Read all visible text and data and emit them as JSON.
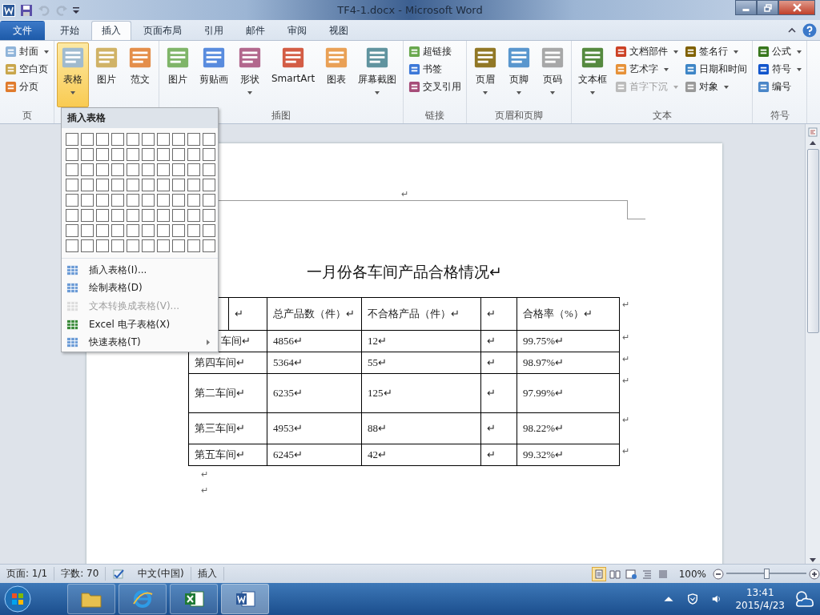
{
  "window": {
    "title": "TF4-1.docx - Microsoft Word"
  },
  "tabs": [
    {
      "label": "文件",
      "kind": "file",
      "selected": false
    },
    {
      "label": "开始",
      "kind": "tab",
      "selected": false
    },
    {
      "label": "插入",
      "kind": "tab",
      "selected": true
    },
    {
      "label": "页面布局",
      "kind": "tab",
      "selected": false
    },
    {
      "label": "引用",
      "kind": "tab",
      "selected": false
    },
    {
      "label": "邮件",
      "kind": "tab",
      "selected": false
    },
    {
      "label": "审阅",
      "kind": "tab",
      "selected": false
    },
    {
      "label": "视图",
      "kind": "tab",
      "selected": false
    }
  ],
  "ribbon_groups": [
    {
      "label": "页",
      "columns": [
        {
          "kind": "stack",
          "items": [
            {
              "label": "封面",
              "caret": true,
              "disabled": false
            },
            {
              "label": "空白页",
              "caret": false,
              "disabled": false
            },
            {
              "label": "分页",
              "caret": false,
              "disabled": false
            }
          ]
        }
      ]
    },
    {
      "columns": [
        {
          "kind": "large",
          "label": "表格",
          "caret": true,
          "active": true
        },
        {
          "kind": "large",
          "label": "图片",
          "caret": false,
          "active": false
        },
        {
          "kind": "large",
          "label": "范文",
          "caret": false,
          "active": false
        }
      ]
    },
    {
      "label": "插图",
      "columns": [
        {
          "kind": "large",
          "label": "图片",
          "caret": false,
          "active": false
        },
        {
          "kind": "large",
          "label": "剪贴画",
          "caret": false,
          "active": false
        },
        {
          "kind": "large",
          "label": "形状",
          "caret": true,
          "active": false
        },
        {
          "kind": "large",
          "label": "SmartArt",
          "caret": false,
          "active": false
        },
        {
          "kind": "large",
          "label": "图表",
          "caret": false,
          "active": false
        },
        {
          "kind": "large",
          "label": "屏幕截图",
          "caret": true,
          "active": false
        }
      ]
    },
    {
      "label": "链接",
      "columns": [
        {
          "kind": "stack",
          "items": [
            {
              "label": "超链接",
              "caret": false,
              "disabled": false
            },
            {
              "label": "书签",
              "caret": false,
              "disabled": false
            },
            {
              "label": "交叉引用",
              "caret": false,
              "disabled": false
            }
          ]
        }
      ]
    },
    {
      "label": "页眉和页脚",
      "columns": [
        {
          "kind": "large",
          "label": "页眉",
          "caret": true,
          "active": false
        },
        {
          "kind": "large",
          "label": "页脚",
          "caret": true,
          "active": false
        },
        {
          "kind": "large",
          "label": "页码",
          "caret": true,
          "active": false
        }
      ]
    },
    {
      "label": "文本",
      "columns": [
        {
          "kind": "large",
          "label": "文本框",
          "caret": true,
          "active": false
        },
        {
          "kind": "stack",
          "items": [
            {
              "label": "文档部件",
              "caret": true,
              "disabled": false
            },
            {
              "label": "艺术字",
              "caret": true,
              "disabled": false
            },
            {
              "label": "首字下沉",
              "caret": true,
              "disabled": true
            }
          ]
        },
        {
          "kind": "stack",
          "items": [
            {
              "label": "签名行",
              "caret": true,
              "disabled": false
            },
            {
              "label": "日期和时间",
              "caret": false,
              "disabled": false
            },
            {
              "label": "对象",
              "caret": true,
              "disabled": false
            }
          ]
        }
      ]
    },
    {
      "label": "符号",
      "columns": [
        {
          "kind": "stack",
          "items": [
            {
              "label": "公式",
              "caret": true,
              "disabled": false
            },
            {
              "label": "符号",
              "caret": true,
              "disabled": false
            },
            {
              "label": "编号",
              "caret": false,
              "disabled": false
            }
          ]
        }
      ]
    }
  ],
  "table_menu": {
    "title": "插入表格",
    "items": [
      {
        "label": "插入表格(I)...",
        "disabled": false,
        "submenu": false
      },
      {
        "label": "绘制表格(D)",
        "disabled": false,
        "submenu": false
      },
      {
        "label": "文本转换成表格(V)...",
        "disabled": true,
        "submenu": false
      },
      {
        "label": "Excel 电子表格(X)",
        "disabled": false,
        "submenu": false
      },
      {
        "label": "快速表格(T)",
        "disabled": false,
        "submenu": true
      }
    ]
  },
  "document": {
    "header_mark": "↵",
    "title": "一月份各车间产品合格情况↵",
    "table": {
      "header": {
        "cells": [
          "↵",
          "总产品数（件）↵",
          "不合格产品（件）↵",
          "↵",
          "合格率（%）↵"
        ],
        "end_mark": "↵"
      },
      "rows": [
        {
          "kind": "covered",
          "cells": [
            "车间↵",
            "4856↵",
            "12↵",
            "↵",
            "99.75%↵"
          ],
          "end_mark": "↵"
        },
        {
          "kind": "plain",
          "cells": [
            "第四车间↵",
            "5364↵",
            "55↵",
            "↵",
            "98.97%↵"
          ],
          "end_mark": "↵"
        },
        {
          "kind": "plain",
          "cells": [
            "第二车间↵",
            "6235↵",
            "125↵",
            "↵",
            "97.99%↵"
          ],
          "end_mark": "↵"
        },
        {
          "kind": "plain",
          "cells": [
            "第三车间↵",
            "4953↵",
            "88↵",
            "↵",
            "98.22%↵"
          ],
          "end_mark": "↵"
        },
        {
          "kind": "plain",
          "cells": [
            "第五车间↵",
            "6245↵",
            "42↵",
            "↵",
            "99.32%↵"
          ],
          "end_mark": "↵"
        }
      ]
    },
    "after_marks": [
      "↵",
      "↵"
    ]
  },
  "status_bar": {
    "page": "页面: 1/1",
    "words": "字数: 70",
    "language": "中文(中国)",
    "mode": "插入",
    "zoom": "100%",
    "zoom_slider": {
      "level": 0.5
    }
  },
  "taskbar": {
    "time": "13:41",
    "date": "2015/4/23"
  }
}
